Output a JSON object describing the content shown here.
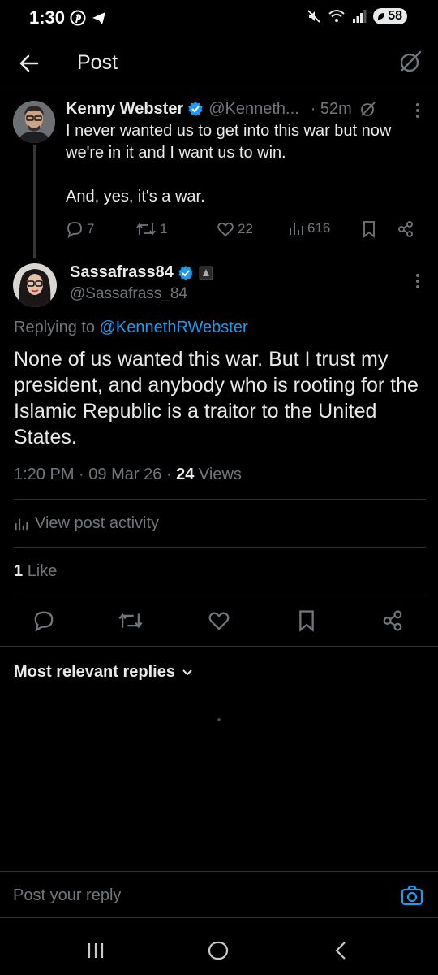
{
  "status_bar": {
    "time": "1:30",
    "battery": "58",
    "network": "6"
  },
  "header": {
    "title": "Post"
  },
  "parent_post": {
    "author_name": "Kenny Webster",
    "handle": "@Kenneth...",
    "time": "· 52m",
    "text": "I never wanted us to get into this war but now we're in it and I want us to win.\n\nAnd, yes, it's a war.",
    "replies": "7",
    "reposts": "1",
    "likes": "22",
    "views": "616"
  },
  "main_post": {
    "author_name": "Sassafrass84",
    "handle": "@Sassafrass_84",
    "replying_prefix": "Replying to",
    "replying_to": "@KennethRWebster",
    "text": "None of us wanted this war. But I trust my president, and anybody who is rooting for the Islamic Republic is a traitor to the United States.",
    "time": "1:20 PM",
    "date": "09 Mar 26",
    "views_count": "24",
    "views_label": "Views",
    "activity_label": "View post activity",
    "likes_count": "1",
    "likes_label": "Like"
  },
  "replies_section": {
    "sort_label": "Most relevant replies"
  },
  "composer": {
    "placeholder": "Post your reply"
  },
  "colors": {
    "accent": "#1d9bf0",
    "muted": "#71767b",
    "text": "#e7e9ea",
    "background": "#000000",
    "border": "#2f3336"
  },
  "icons": [
    "back-arrow-icon",
    "grok-icon",
    "verified-badge-icon",
    "more-icon",
    "reply-icon",
    "repost-icon",
    "like-icon",
    "views-icon",
    "bookmark-icon",
    "share-icon",
    "chevron-down-icon",
    "camera-icon",
    "recents-icon",
    "home-icon",
    "back-nav-icon"
  ]
}
